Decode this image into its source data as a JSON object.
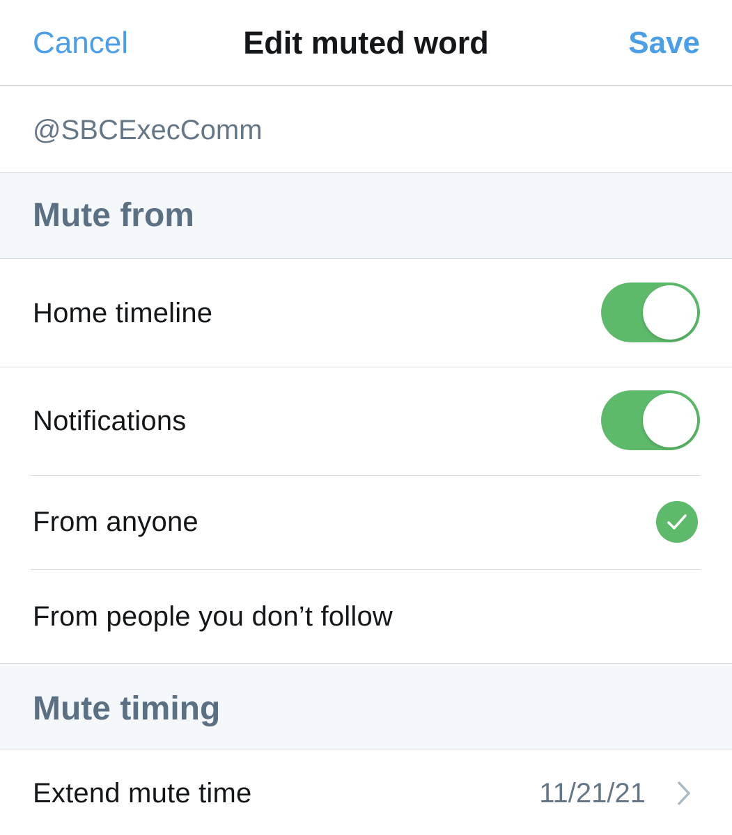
{
  "navbar": {
    "cancel_label": "Cancel",
    "title": "Edit muted word",
    "save_label": "Save"
  },
  "muted_word": {
    "value": "@SBCExecComm"
  },
  "mute_from": {
    "header": "Mute from",
    "home_timeline": {
      "label": "Home timeline",
      "enabled": true
    },
    "notifications": {
      "label": "Notifications",
      "enabled": true
    },
    "options": [
      {
        "label": "From anyone",
        "selected": true
      },
      {
        "label": "From people you don’t follow",
        "selected": false
      }
    ]
  },
  "mute_timing": {
    "header": "Mute timing",
    "extend": {
      "label": "Extend mute time",
      "value": "11/21/21"
    }
  },
  "colors": {
    "accent_blue": "#4a9fe8",
    "toggle_green": "#5cba6a",
    "section_bg": "#f5f8fa",
    "section_text": "#5b7083",
    "primary_text": "#14171a",
    "secondary_text": "#657786",
    "divider": "#d9dadc"
  },
  "icons": {
    "selected_indicator": "checkmark-circle-icon",
    "disclosure": "chevron-right-icon"
  }
}
